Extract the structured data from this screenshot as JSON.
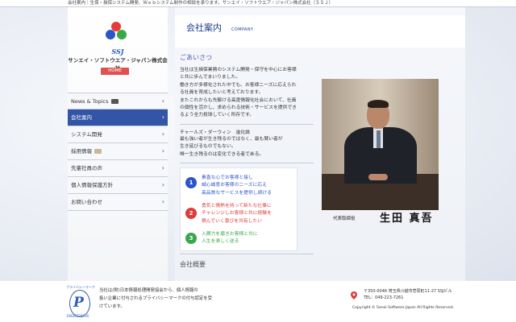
{
  "topbar": {
    "text": "会社案内｜生保・損保システム開発、Ｗｅｂシステム制作の相談を承ります。サンエイ・ソフトウエア・ジャパン株式会社（ＳＳＪ）"
  },
  "sidebar": {
    "logo_text": "SSJ",
    "company_name": "サンエイ・ソフトウエア・ジャパン株式会社",
    "home_label": "HOME",
    "items": [
      {
        "label": "News & Topics",
        "icon": "camera-icon"
      },
      {
        "label": "会社案内"
      },
      {
        "label": "システム開発"
      },
      {
        "label": "採用情報",
        "icon": "image-icon"
      },
      {
        "label": "先輩社員の声"
      },
      {
        "label": "個人情報保護方針"
      },
      {
        "label": "お問い合わせ"
      }
    ],
    "active_index": 1
  },
  "main": {
    "title": "会社案内",
    "subtitle": "COMPANY",
    "greeting_title": "ごあいさつ",
    "greeting_lines": [
      "当社は生損保業務のシステム開発・保守を中心にお客様",
      "と共に歩んでまいりました。",
      "働き方が多様化された中でも、お客様ニーズに応えられ",
      "る社員を育成したいと考えております。",
      "またこれからも先駆ける高度情報化社会において、社員",
      "の個性を活かし、求められる技術・サービスを提供でき",
      "るよう全力投球していく所存です。"
    ],
    "quote_title": "チャールズ・ダーウィン　進化論",
    "quote_lines": [
      "最も強い者が生き残るのではなく、最も賢い者が",
      "生き延びるものでもない。",
      "唯一生き残るのは変化できる者である。"
    ],
    "motto": [
      {
        "num": "1",
        "color": "#2b56c9",
        "text_color": "#2b56c9",
        "lines": [
          "素直な心でお客様と接し",
          "誠心誠意お客様のニーズに応え",
          "高品質なサービスを提供し続ける"
        ]
      },
      {
        "num": "2",
        "color": "#e03b3b",
        "text_color": "#e03b3b",
        "lines": [
          "勇気と情熱を持って新たな仕事に",
          "チャレンジしお客様と共に経験を",
          "積んでいく喜びを共有したい"
        ]
      },
      {
        "num": "3",
        "color": "#39a84a",
        "text_color": "#39a84a",
        "lines": [
          "入間力を磨きお客様と共に",
          "人生を楽しく送る"
        ]
      }
    ],
    "sign_title": "代表取締役",
    "sign_name": "生田 真吾",
    "section_title": "会社概要"
  },
  "footer": {
    "pmark_letter": "P",
    "pmark_arc": "プライバシーマーク",
    "pmark_number": "10820776(10)",
    "pmark_lines": [
      "当社は(財)日本情報処理開発協会から、個人情報の",
      "扱い企業に付与されるプライバシーマークの付与認定を受",
      "けています。"
    ],
    "address_line1": "〒350-0046 埼玉県川越市菅原町11-27 SSJビル",
    "address_line2": "TEL：049-223-7261",
    "copyright": "Copyright © Sanei Software Japan All Rights Reserved."
  }
}
